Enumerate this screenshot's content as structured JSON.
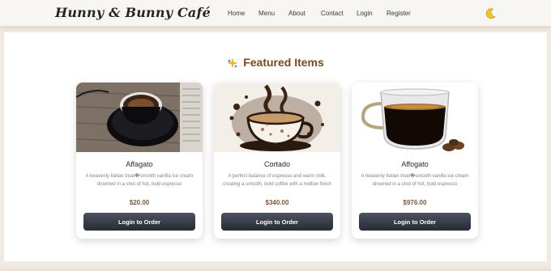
{
  "brand": "Hunny & Bunny Café",
  "nav": {
    "items": [
      "Home",
      "Menu",
      "About",
      "Contact",
      "Login",
      "Register"
    ]
  },
  "theme_toggle_icon": "crescent-moon-icon",
  "featured": {
    "title": "Featured Items",
    "title_icon": "sparkle-icon",
    "items": [
      {
        "name": "Affagato",
        "description": "A heavenly Italian treat�smooth vanilla ice cream drowned in a shot of hot, bold espresso",
        "price": "$20.00",
        "button": "Login to Order",
        "image": "espresso-cup-on-saucer"
      },
      {
        "name": "Cortado",
        "description": "A perfect balance of espresso and warm milk, creating a smooth, bold coffee with a mellow finish",
        "price": "$340.00",
        "button": "Login to Order",
        "image": "illustrated-coffee-cup"
      },
      {
        "name": "Affogato",
        "description": "A heavenly Italian treat�smooth vanilla ice cream drowned in a shot of hot, bold espresso",
        "price": "$976.00",
        "button": "Login to Order",
        "image": "glass-espresso-cup"
      }
    ]
  },
  "colors": {
    "accent_title": "#7a4a1e",
    "button_dark": "#2d323c",
    "price": "#7a5a3a"
  }
}
